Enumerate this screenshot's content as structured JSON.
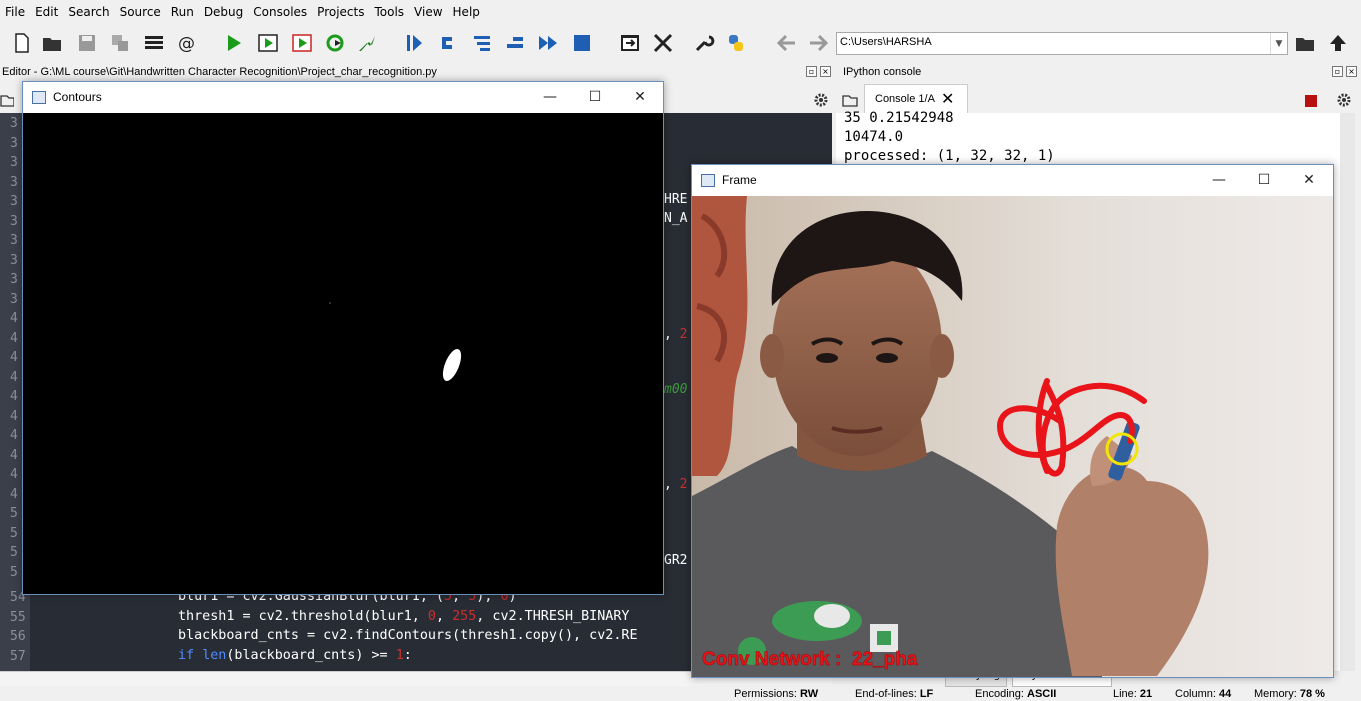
{
  "menu": [
    "File",
    "Edit",
    "Search",
    "Source",
    "Run",
    "Debug",
    "Consoles",
    "Projects",
    "Tools",
    "View",
    "Help"
  ],
  "toolbar": {
    "path": "C:\\Users\\HARSHA",
    "icons": [
      "new-file-icon",
      "open-folder-icon",
      "save-icon",
      "save-all-icon",
      "outline-icon",
      "at-icon",
      "run-icon",
      "run-cell-icon",
      "run-cell-advance-icon",
      "rerun-icon",
      "debug-icon",
      "step-icon",
      "step-into-icon",
      "step-return-icon",
      "step-over-icon",
      "continue-icon",
      "stop-icon",
      "maximize-pane-icon",
      "fullscreen-icon",
      "wrench-icon",
      "python-icon",
      "back-icon",
      "forward-icon"
    ]
  },
  "editor": {
    "title": "Editor - G:\\ML course\\Git\\Handwritten Character Recognition\\Project_char_recognition.py",
    "gutter_numbers": [
      "3",
      "3",
      "3",
      "3",
      "3",
      "3",
      "3",
      "3",
      "3",
      "3",
      "4",
      "4",
      "4",
      "4",
      "4",
      "4",
      "4",
      "4",
      "4",
      "4",
      "5",
      "5",
      "5",
      "5"
    ],
    "lines": [
      {
        "num": "54",
        "parts": [
          [
            "t",
            "blur1 = cv2.GaussianBlur(blur1, ("
          ],
          [
            "n",
            "5"
          ],
          [
            "t",
            ", "
          ],
          [
            "n",
            "5"
          ],
          [
            "t",
            "), "
          ],
          [
            "n",
            "0"
          ],
          [
            "t",
            ")"
          ]
        ]
      },
      {
        "num": "55",
        "parts": [
          [
            "t",
            "thresh1 = cv2.threshold(blur1, "
          ],
          [
            "n",
            "0"
          ],
          [
            "t",
            ", "
          ],
          [
            "n",
            "255"
          ],
          [
            "t",
            ", cv2.THRESH_BINARY"
          ]
        ]
      },
      {
        "num": "56",
        "parts": [
          [
            "t",
            "blackboard_cnts = cv2.findContours(thresh1.copy(), cv2.RE"
          ]
        ]
      },
      {
        "num": "57",
        "parts": [
          [
            "k",
            "if"
          ],
          [
            "t",
            " "
          ],
          [
            "k",
            "len"
          ],
          [
            "t",
            "(blackboard_cnts) >= "
          ],
          [
            "n",
            "1"
          ],
          [
            "t",
            ":"
          ]
        ]
      }
    ],
    "fragments": [
      "HRE",
      "N_A",
      ", 2",
      "m00",
      ", 2",
      "GR2"
    ]
  },
  "console_pane": {
    "header": "IPython console",
    "tab": "Console 1/A",
    "lines": [
      "35 0.21542948",
      "10474.0",
      "processed: (1, 32, 32, 1)"
    ]
  },
  "contours_window": {
    "title": "Contours"
  },
  "frame_window": {
    "title": "Frame",
    "overlay_text": "Conv Network :  22_pha"
  },
  "bottom_tabs": [
    "History log",
    "IPython console"
  ],
  "statusbar": {
    "permissions_label": "Permissions:",
    "permissions": "RW",
    "eol_label": "End-of-lines:",
    "eol": "LF",
    "encoding_label": "Encoding:",
    "encoding": "ASCII",
    "line_label": "Line:",
    "line": "21",
    "column_label": "Column:",
    "column": "44",
    "memory_label": "Memory:",
    "memory": "78 %"
  },
  "colors": {
    "editor_bg": "#282c34",
    "number": "#c9302c",
    "keyword": "#4e8cff",
    "stroke_red": "#e8141a",
    "tracker_yellow": "#f2e600"
  }
}
